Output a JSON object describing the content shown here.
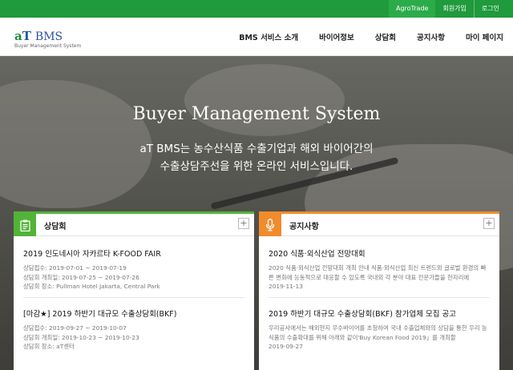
{
  "topbar": {
    "links": [
      "AgroTrade",
      "회원가입",
      "로그인"
    ],
    "color": "#1f9a3c"
  },
  "logo": {
    "mark_a": "a",
    "mark_t": "T",
    "name": "BMS",
    "sub": "Buyer Management System"
  },
  "nav": [
    "BMS 서비스 소개",
    "바이어정보",
    "상담회",
    "공지사항",
    "마이 페이지"
  ],
  "hero": {
    "title": "Buyer Management System",
    "line1": "aT BMS는 농수산식품 수출기업과 해외 바이어간의",
    "line2": "수출상담주선을 위한 온라인 서비스입니다."
  },
  "consult": {
    "title": "상담회",
    "accent": "#52b437",
    "icon": "clipboard-icon",
    "more": "+",
    "items": [
      {
        "title": "2019 인도네시아 자카르타 K-FOOD FAIR",
        "lines": [
          "상담접수: 2019-07-01 ~ 2019-07-19",
          "상담회 개최일: 2019-07-25 ~ 2019-07-26",
          "상담회 장소: Pullman Hotel Jakarta, Central Park"
        ]
      },
      {
        "title": "[마감★] 2019 하반기 대규모 수출상담회(BKF)",
        "lines": [
          "상담접수: 2019-09-27 ~ 2019-10-07",
          "상담회 개최일: 2019-10-23 ~ 2019-10-23",
          "상담회 장소: aT센터"
        ]
      }
    ]
  },
  "notice": {
    "title": "공지사항",
    "accent": "#f28b2c",
    "icon": "microphone-icon",
    "more": "+",
    "items": [
      {
        "title": "2020 식품·외식산업 전망대회",
        "desc": "2020 식품·외식산업 전망대회 개최 안내 식품·외식산업 최신 트렌드와 글로벌 환경의 빠른 변화에 능동적으로 대응할 수 있도록 국내외 각 분야 대표 전문가들을 한자리에",
        "date": "2019-11-13"
      },
      {
        "title": "2019 하반기 대규모 수출상담회(BKF) 참가업체 모집 공고",
        "desc": "우리공사에서는 해외현지 우수바이어를 초청하여 국내 수출업체와의 상담을 통한 우리 농식품의 수출확대를 위해 아래와 같이'Buy Korean Food 2019」를 개최할",
        "date": "2019-09-27"
      }
    ]
  }
}
